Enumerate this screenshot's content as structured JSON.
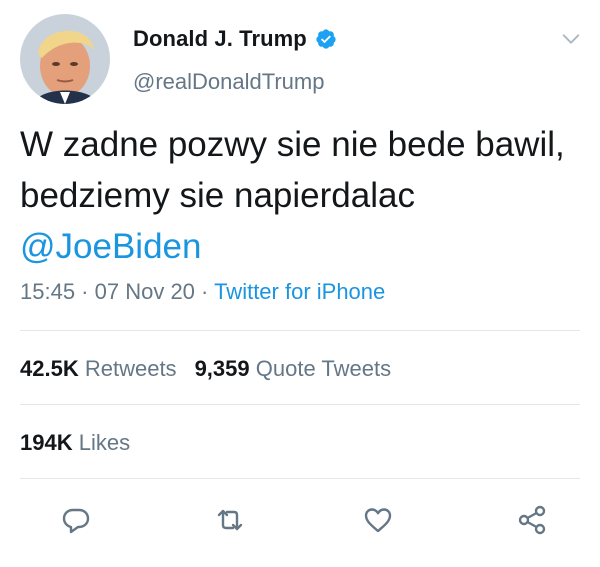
{
  "author": {
    "display_name": "Donald J. Trump",
    "handle": "@realDonaldTrump",
    "verified": true
  },
  "tweet": {
    "text": "W zadne pozwy sie nie bede bawil, bedziemy sie napierdalac ",
    "mention": "@JoeBiden"
  },
  "meta": {
    "time": "15:45",
    "separator": " · ",
    "date": "07 Nov 20",
    "source": "Twitter for iPhone"
  },
  "stats": {
    "retweets_count": "42.5K",
    "retweets_label": "Retweets",
    "quote_count": "9,359",
    "quote_label": "Quote Tweets",
    "likes_count": "194K",
    "likes_label": "Likes"
  },
  "icons": {
    "verified": "verified-badge-icon",
    "menu": "chevron-down-icon",
    "reply": "reply-icon",
    "retweet": "retweet-icon",
    "like": "heart-icon",
    "share": "share-icon"
  },
  "colors": {
    "link": "#1b95e0",
    "secondary_text": "#657786",
    "primary_text": "#14171a",
    "divider": "#e1e8ed",
    "verified": "#1da1f2"
  }
}
